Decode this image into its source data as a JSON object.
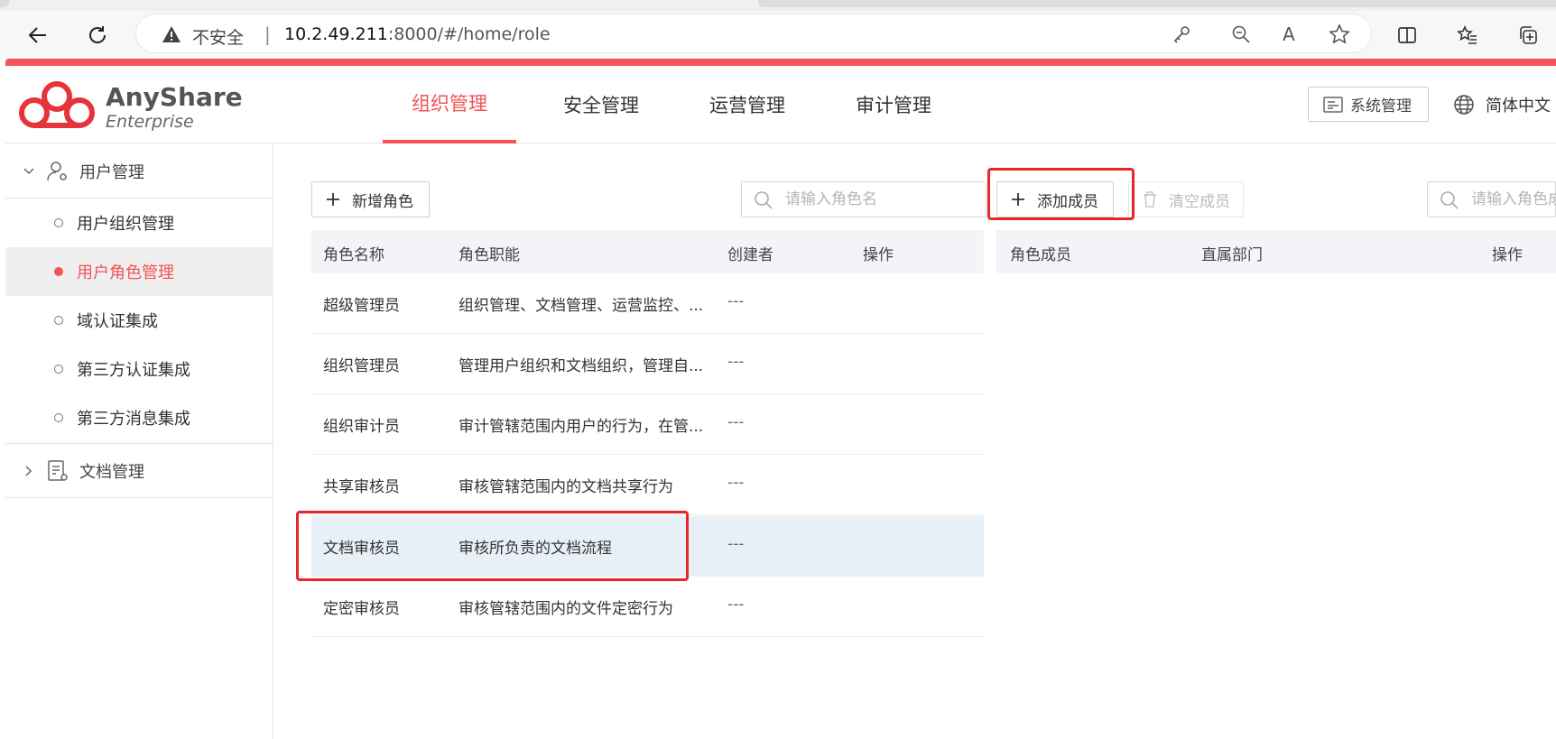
{
  "browser": {
    "security_label": "不安全",
    "url_host": "10.2.49.211",
    "url_rest": ":8000/#/home/role",
    "reader_glyph": "A"
  },
  "app": {
    "logo_name": "AnyShare",
    "logo_sub": "Enterprise",
    "nav_tabs": [
      "组织管理",
      "安全管理",
      "运营管理",
      "审计管理"
    ],
    "active_tab": "组织管理",
    "system_button": "系统管理",
    "language": "简体中文",
    "accent_color": "#f25354"
  },
  "sidebar": {
    "groups": [
      {
        "label": "用户管理",
        "expanded": true,
        "items": [
          {
            "label": "用户组织管理"
          },
          {
            "label": "用户角色管理",
            "active": true
          },
          {
            "label": "域认证集成"
          },
          {
            "label": "第三方认证集成"
          },
          {
            "label": "第三方消息集成"
          }
        ]
      },
      {
        "label": "文档管理",
        "expanded": false
      }
    ]
  },
  "roles_panel": {
    "add_role_button": "新增角色",
    "search_placeholder": "请输入角色名",
    "columns": [
      "角色名称",
      "角色职能",
      "创建者",
      "操作"
    ],
    "rows": [
      {
        "name": "超级管理员",
        "duty": "组织管理、文档管理、运营监控、...",
        "creator": "---"
      },
      {
        "name": "组织管理员",
        "duty": "管理用户组织和文档组织，管理自...",
        "creator": "---"
      },
      {
        "name": "组织审计员",
        "duty": "审计管辖范围内用户的行为，在管...",
        "creator": "---"
      },
      {
        "name": "共享审核员",
        "duty": "审核管辖范围内的文档共享行为",
        "creator": "---"
      },
      {
        "name": "文档审核员",
        "duty": "审核所负责的文档流程",
        "creator": "---",
        "selected": true
      },
      {
        "name": "定密审核员",
        "duty": "审核管辖范围内的文件定密行为",
        "creator": "---"
      }
    ]
  },
  "members_panel": {
    "add_member_button": "添加成员",
    "clear_members_button": "清空成员",
    "search_placeholder": "请输入角色成员",
    "columns": [
      "角色成员",
      "直属部门",
      "操作"
    ]
  }
}
